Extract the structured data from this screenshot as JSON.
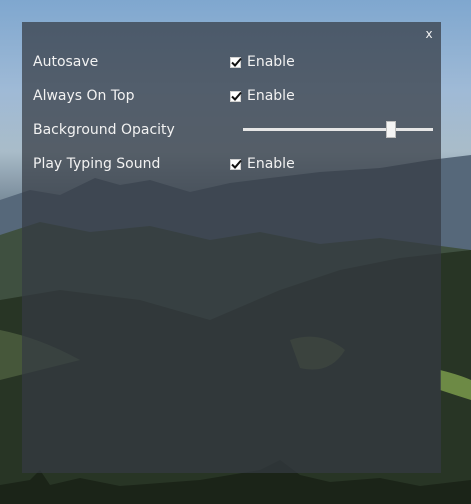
{
  "window": {
    "close_label": "x"
  },
  "settings": [
    {
      "label": "Autosave",
      "control": "checkbox",
      "checked": true,
      "option_label": "Enable"
    },
    {
      "label": "Always On Top",
      "control": "checkbox",
      "checked": true,
      "option_label": "Enable"
    },
    {
      "label": "Background Opacity",
      "control": "slider",
      "value": 0.78
    },
    {
      "label": "Play Typing Sound",
      "control": "checkbox",
      "checked": true,
      "option_label": "Enable"
    }
  ],
  "colors": {
    "panel_bg": "#343a42",
    "text": "#f2f2f2"
  }
}
